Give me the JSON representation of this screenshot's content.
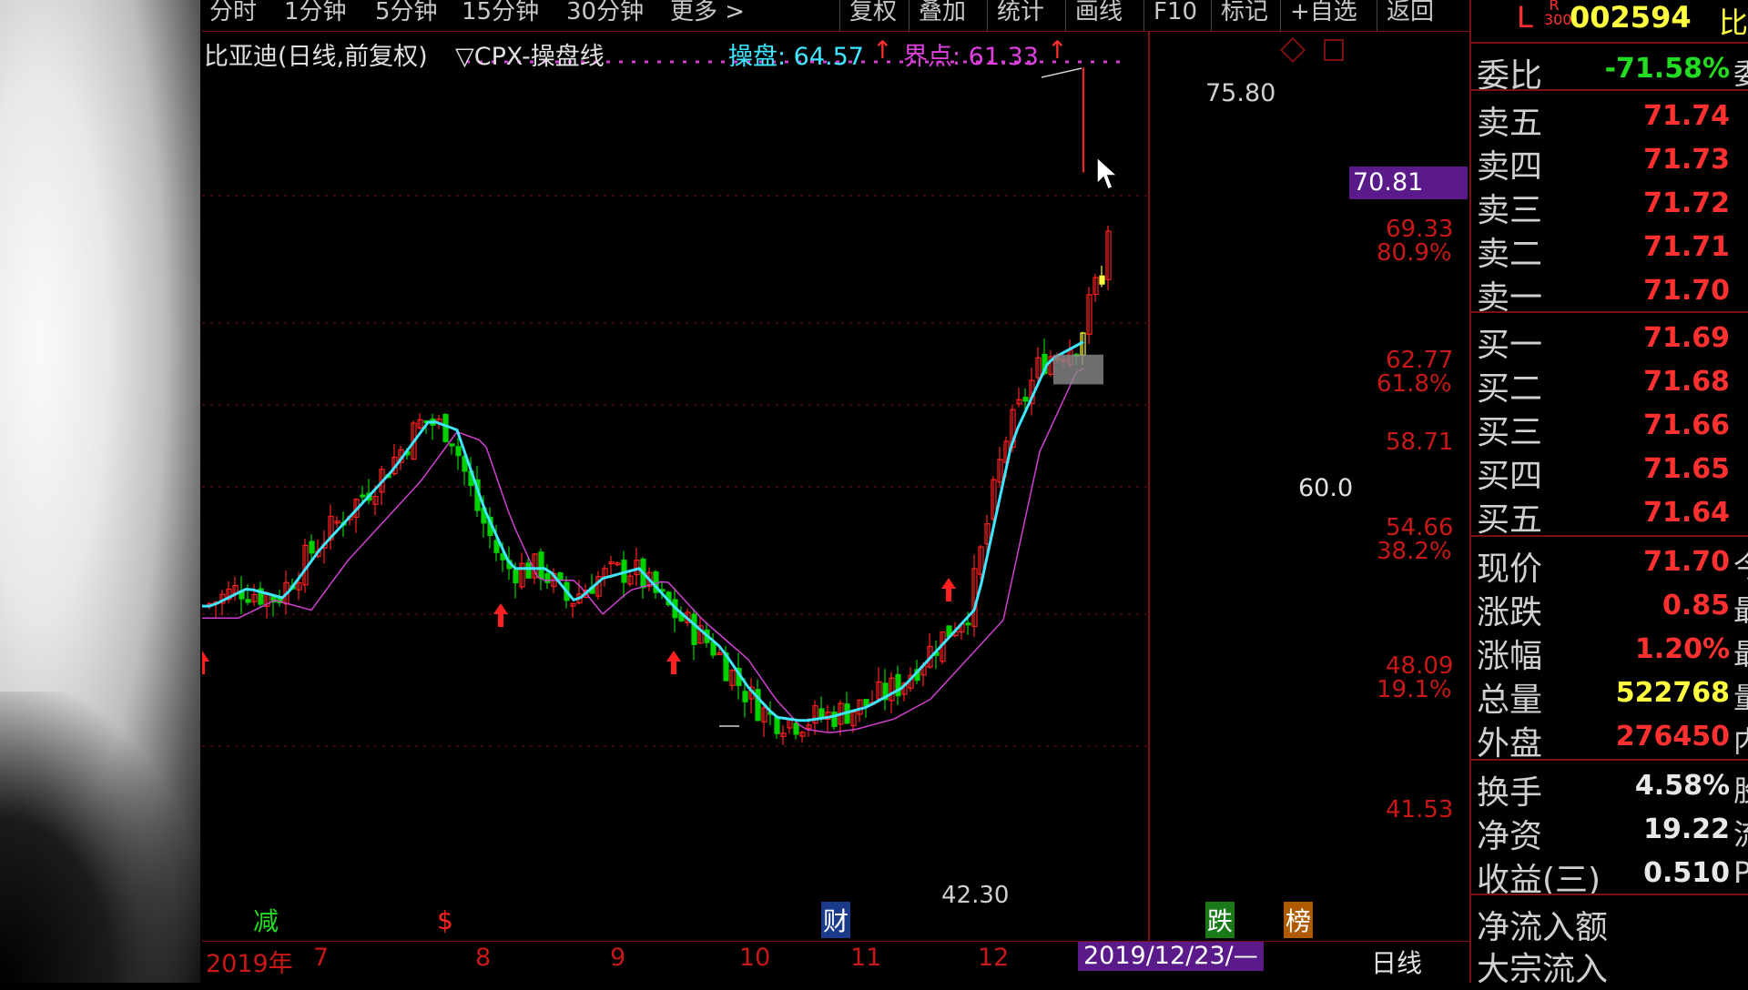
{
  "toolbar": {
    "period_tabs": [
      "分时",
      "1分钟",
      "5分钟",
      "15分钟",
      "30分钟",
      "更多 >"
    ],
    "actions": [
      "复权",
      "叠加",
      "统计",
      "画线",
      "F10",
      "标记",
      "+自选",
      "返回"
    ]
  },
  "chart_header": {
    "title": "比亚迪(日线,前复权)",
    "indicator": "▽CPX-操盘线",
    "op_label": "操盘: 64.57",
    "bound_label": "界点: 61.33",
    "up_arrow": "↑"
  },
  "price_axis": {
    "current_price_tag": "70.81",
    "levels": [
      "69.33",
      "62.77",
      "58.71",
      "54.66",
      "48.09",
      "41.53"
    ],
    "fib_levels": [
      "80.9%",
      "61.8%",
      "38.2%",
      "19.1%"
    ]
  },
  "annotations": {
    "high": "75.80",
    "low": "42.30",
    "box_value": "60.0"
  },
  "event_markers": [
    "减",
    "$",
    "财",
    "跌",
    "榜"
  ],
  "time_axis": {
    "labels": [
      "2019年",
      "7",
      "8",
      "9",
      "10",
      "11",
      "12"
    ],
    "cursor_date": "2019/12/23/—",
    "period": "日线"
  },
  "quote_panel": {
    "stock_code": "002594",
    "stock_name_cut": "比",
    "market_tag": "L",
    "index_tag": "R 300",
    "weibi": {
      "label": "委比",
      "value": "-71.58%",
      "cut": "委"
    },
    "asks": [
      {
        "label": "卖五",
        "value": "71.74"
      },
      {
        "label": "卖四",
        "value": "71.73"
      },
      {
        "label": "卖三",
        "value": "71.72"
      },
      {
        "label": "卖二",
        "value": "71.71"
      },
      {
        "label": "卖一",
        "value": "71.70"
      }
    ],
    "bids": [
      {
        "label": "买一",
        "value": "71.69"
      },
      {
        "label": "买二",
        "value": "71.68"
      },
      {
        "label": "买三",
        "value": "71.66"
      },
      {
        "label": "买四",
        "value": "71.65"
      },
      {
        "label": "买五",
        "value": "71.64"
      }
    ],
    "stats": [
      {
        "label": "现价",
        "value": "71.70",
        "cut": "今"
      },
      {
        "label": "涨跌",
        "value": "0.85",
        "cut": "最"
      },
      {
        "label": "涨幅",
        "value": "1.20%",
        "cut": "最"
      },
      {
        "label": "总量",
        "value": "522768",
        "cut": "量"
      },
      {
        "label": "外盘",
        "value": "276450",
        "cut": "内"
      }
    ],
    "fundamentals": [
      {
        "label": "换手",
        "value": "4.58%",
        "cut": "股"
      },
      {
        "label": "净资",
        "value": "19.22",
        "cut": "流"
      },
      {
        "label": "收益(三)",
        "value": "0.510",
        "cut": "P"
      }
    ],
    "flows": [
      "净流入额",
      "大宗流入"
    ]
  },
  "colors": {
    "up": "#ff2020",
    "down": "#00d200",
    "ma_fast": "#3ee6ff",
    "ma_slow": "#d040d0",
    "grid": "#7a1010",
    "ask_price": "#ff3030",
    "weibi": "#22dd22",
    "volume": "#ffff40"
  }
}
